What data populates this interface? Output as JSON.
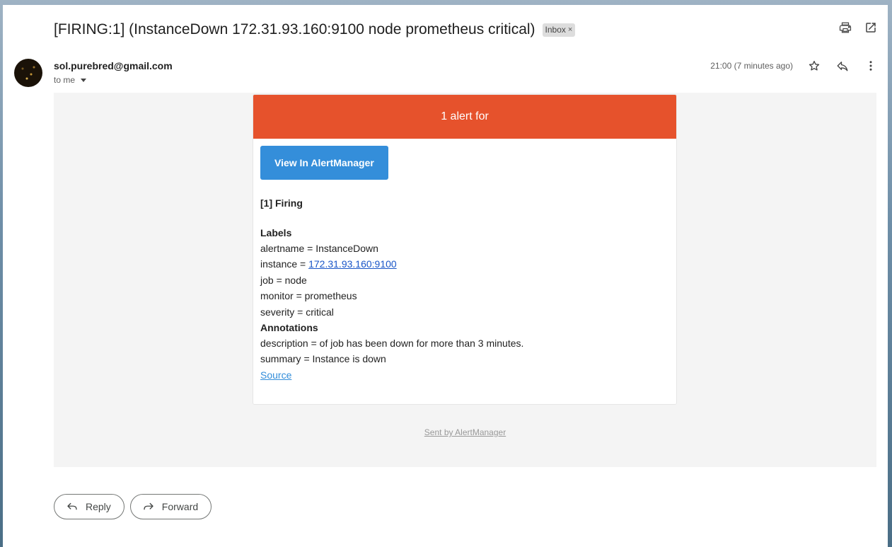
{
  "email": {
    "subject": "[FIRING:1] (InstanceDown 172.31.93.160:9100 node prometheus critical)",
    "label_chip": "Inbox",
    "label_chip_close": "×",
    "sender": "sol.purebred@gmail.com",
    "recipient_text": "to me",
    "timestamp": "21:00 (7 minutes ago)"
  },
  "alert": {
    "header": "1 alert for",
    "button_label": "View In AlertManager",
    "firing_title": "[1] Firing",
    "labels_title": "Labels",
    "labels": [
      {
        "text": "alertname = InstanceDown"
      },
      {
        "prefix": "instance = ",
        "link": "172.31.93.160:9100"
      },
      {
        "text": "job = node"
      },
      {
        "text": "monitor = prometheus"
      },
      {
        "text": "severity = critical"
      }
    ],
    "annotations_title": "Annotations",
    "annotations": [
      "description = of job has been down for more than 3 minutes.",
      "summary = Instance is down"
    ],
    "source_link": "Source",
    "footer": "Sent by AlertManager"
  },
  "actions": {
    "reply": "Reply",
    "forward": "Forward"
  },
  "colors": {
    "alert_header": "#e6522c",
    "button": "#348eda",
    "body_bg": "#f4f4f4"
  },
  "icons": [
    "print-icon",
    "open-new-window-icon",
    "star-icon",
    "reply-icon",
    "more-vert-icon",
    "forward-icon"
  ]
}
